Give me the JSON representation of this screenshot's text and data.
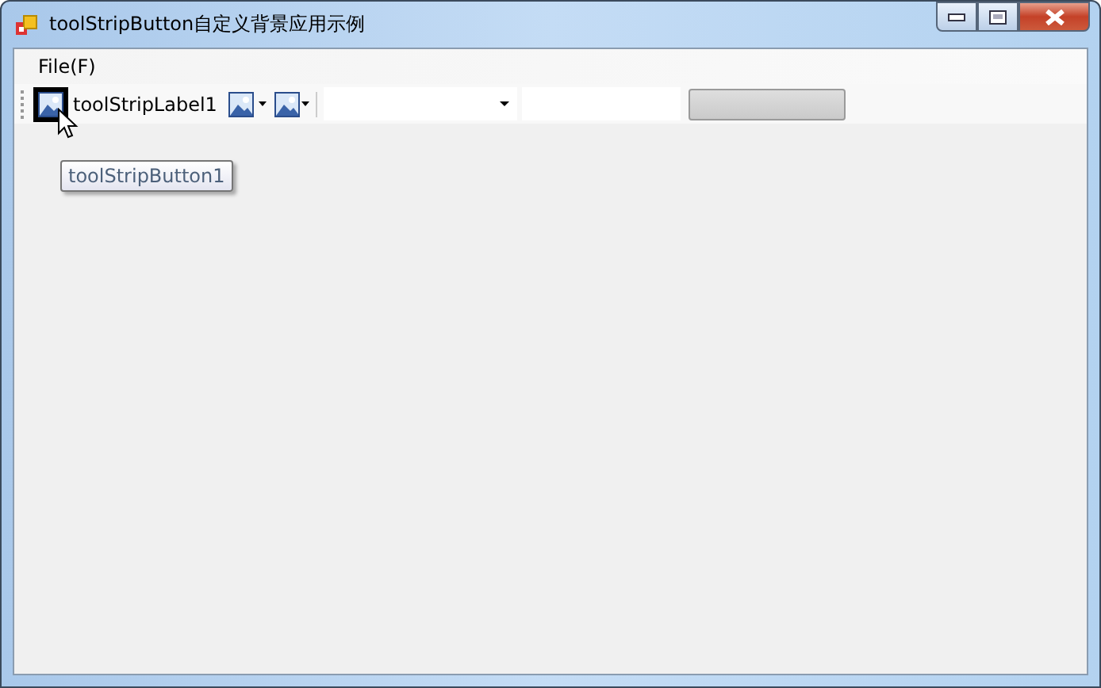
{
  "window": {
    "title": "toolStripButton自定义背景应用示例"
  },
  "menu": [
    {
      "label": "File(F)"
    }
  ],
  "toolbar": [
    {
      "kind": "button",
      "hot": true
    },
    {
      "kind": "label",
      "text": "toolStripLabel1"
    },
    {
      "kind": "split"
    },
    {
      "kind": "dropdown"
    },
    {
      "kind": "separator"
    },
    {
      "kind": "combo"
    },
    {
      "kind": "textbox"
    },
    {
      "kind": "progress",
      "level": 0
    }
  ],
  "tooltip": "toolStripButton1"
}
